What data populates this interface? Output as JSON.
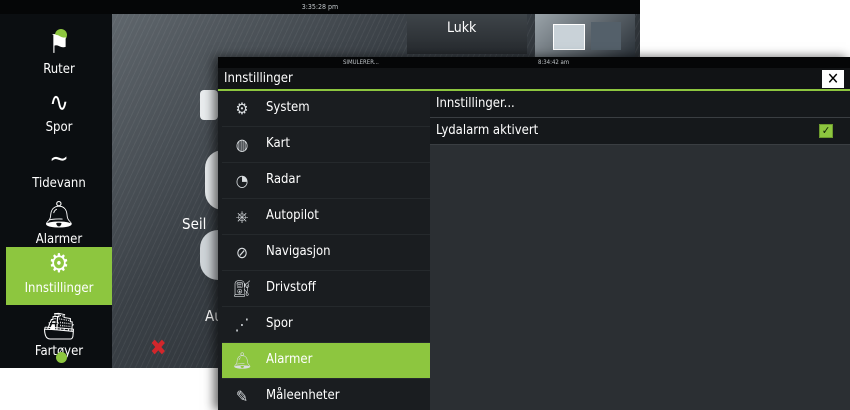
{
  "background": {
    "clock": "3:35:28 pm",
    "close_button": "Lukk",
    "partial_labels": [
      "Seil",
      "Au"
    ]
  },
  "sidebar": {
    "items": [
      {
        "label": "Ruter",
        "icon": "route-icon"
      },
      {
        "label": "Spor",
        "icon": "track-icon"
      },
      {
        "label": "Tidevann",
        "icon": "tide-icon"
      },
      {
        "label": "Alarmer",
        "icon": "bell-icon"
      },
      {
        "label": "Innstillinger",
        "icon": "gear-icon"
      },
      {
        "label": "Fartøyer",
        "icon": "vessels-icon"
      }
    ]
  },
  "dialog": {
    "status_simulating": "SIMULERER...",
    "status_time": "8:34:42 am",
    "title": "Innstillinger",
    "menu": [
      {
        "label": "System",
        "icon": "gear-icon"
      },
      {
        "label": "Kart",
        "icon": "globe-icon"
      },
      {
        "label": "Radar",
        "icon": "radar-icon"
      },
      {
        "label": "Autopilot",
        "icon": "autopilot-icon"
      },
      {
        "label": "Navigasjon",
        "icon": "compass-icon"
      },
      {
        "label": "Drivstoff",
        "icon": "fuel-icon"
      },
      {
        "label": "Spor",
        "icon": "track-icon"
      },
      {
        "label": "Alarmer",
        "icon": "bell-icon"
      },
      {
        "label": "Måleenheter",
        "icon": "ruler-icon"
      }
    ],
    "rows": [
      {
        "label": "Innstillinger..."
      },
      {
        "label": "Lydalarm aktivert",
        "checked": true
      }
    ]
  },
  "colors": {
    "accent": "#8dc63f",
    "panel": "#1a1d20",
    "alert": "#d2262b"
  }
}
